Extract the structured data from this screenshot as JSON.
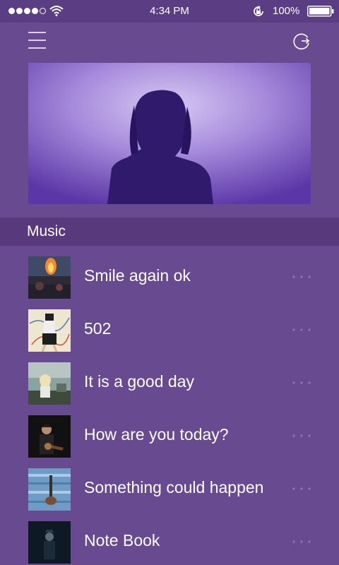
{
  "status_bar": {
    "time": "4:34 PM",
    "battery": "100%",
    "icons": [
      "signal-dots-icon",
      "wifi-icon",
      "rotation-lock-icon",
      "battery-icon"
    ]
  },
  "nav": {
    "icons": [
      "menu-icon",
      "refresh-icon"
    ]
  },
  "colors": {
    "background": "#684a91",
    "status_bar": "#5a3d83",
    "section_header": "#58397c",
    "text": "#ffffff"
  },
  "section": {
    "title": "Music"
  },
  "songs": [
    {
      "title": "Smile again ok"
    },
    {
      "title": "502"
    },
    {
      "title": "It is a good day"
    },
    {
      "title": "How are you today?"
    },
    {
      "title": "Something could happen"
    },
    {
      "title": "Note Book"
    }
  ]
}
